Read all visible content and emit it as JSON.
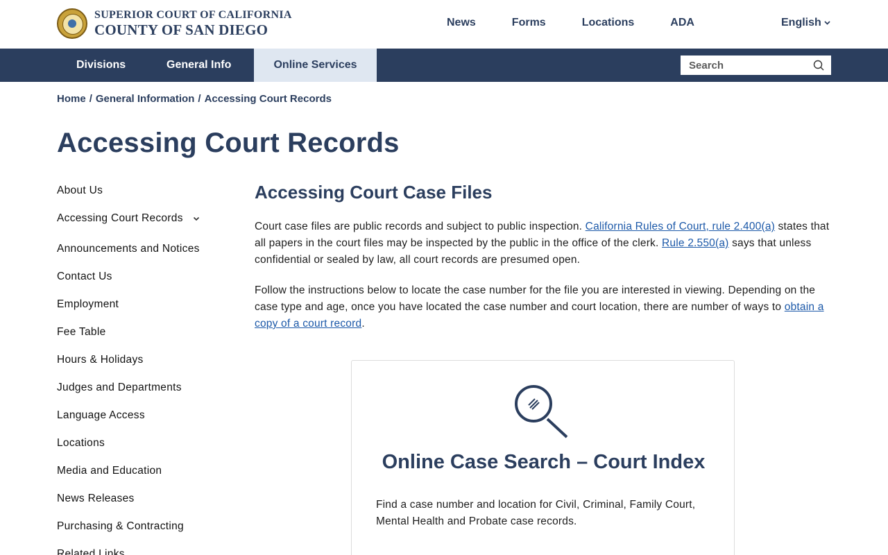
{
  "header": {
    "logo": {
      "line1": "SUPERIOR COURT OF CALIFORNIA",
      "line2": "COUNTY OF SAN DIEGO"
    },
    "top_links": [
      "News",
      "Forms",
      "Locations",
      "ADA"
    ],
    "language": "English"
  },
  "main_nav": {
    "items": [
      "Divisions",
      "General Info",
      "Online Services"
    ],
    "active": "Online Services",
    "search_placeholder": "Search"
  },
  "breadcrumb": [
    "Home",
    "General Information",
    "Accessing Court Records"
  ],
  "page_title": "Accessing Court Records",
  "sidebar": {
    "items": [
      "About Us",
      "Accessing Court Records",
      "Announcements and Notices",
      "Contact Us",
      "Employment",
      "Fee Table",
      "Hours & Holidays",
      "Judges and Departments",
      "Language Access",
      "Locations",
      "Media and Education",
      "News Releases",
      "Purchasing & Contracting",
      "Related Links"
    ]
  },
  "content": {
    "heading": "Accessing Court Case Files",
    "p1_a": "Court case files are public records and subject to public inspection. ",
    "p1_link1": "California Rules of Court, rule 2.400(a)",
    "p1_b": " states that all papers in the court files may be inspected by the public in the office of the clerk. ",
    "p1_link2": "Rule 2.550(a)",
    "p1_c": " says that unless confidential or sealed by law, all court records are presumed open.",
    "p2_a": "Follow the instructions below to locate the case number for the file you are interested in viewing. Depending on the case type and age, once you have located the case number and court location, there are number of ways to ",
    "p2_link": "obtain a copy of a court record",
    "p2_b": "."
  },
  "card": {
    "icon": "magnifying-glass-icon",
    "title": "Online Case Search – Court Index",
    "text": "Find a case number and location for Civil, Criminal, Family Court, Mental Health and Probate case records."
  },
  "colors": {
    "navy": "#2b3e5e",
    "active_tab_bg": "#dfe7f1",
    "link": "#1b58a8"
  }
}
